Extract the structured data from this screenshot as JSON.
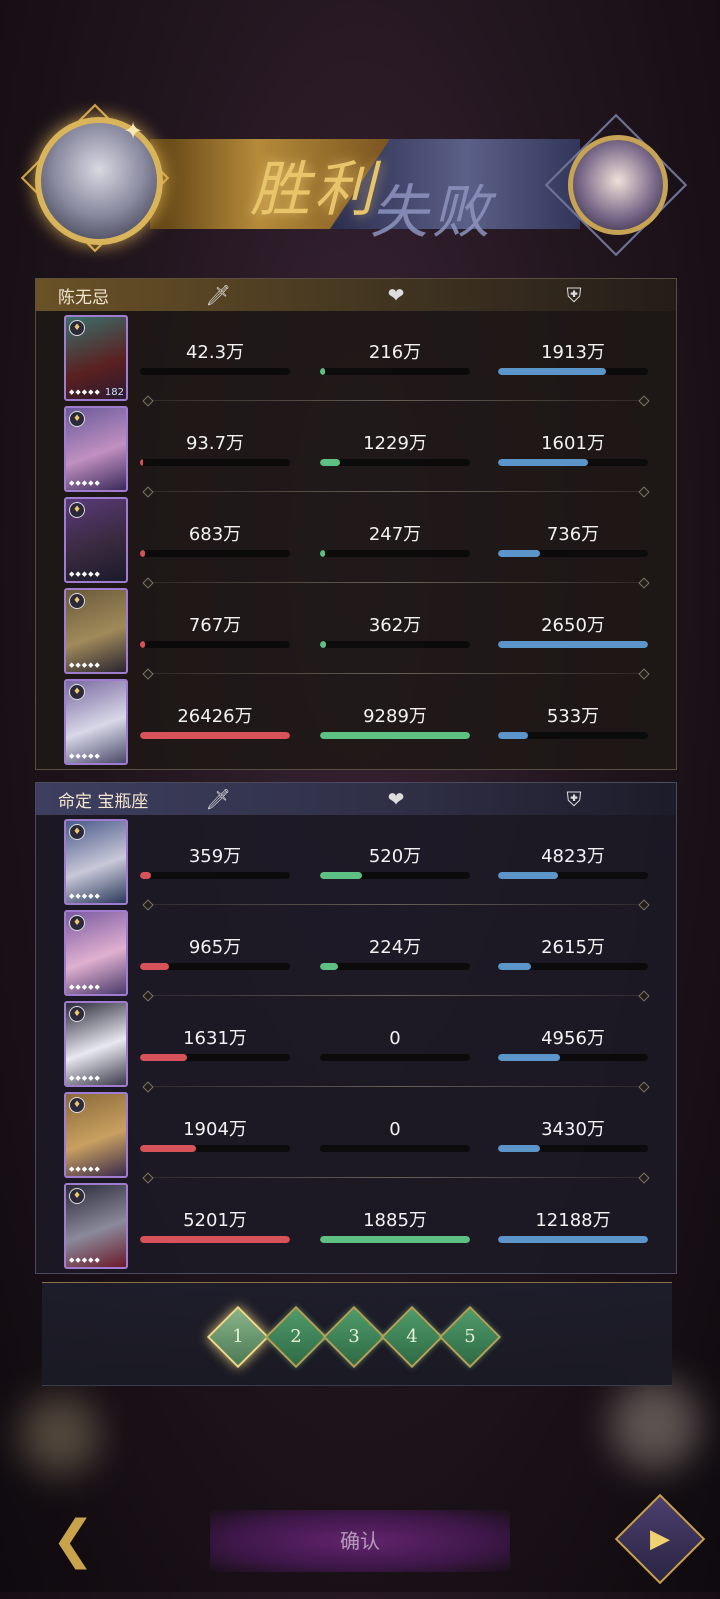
{
  "result": {
    "win_text": "胜利",
    "lose_text": "失败"
  },
  "panels": [
    {
      "name": "陈无忌",
      "theme": "gold",
      "rows": [
        {
          "level": "182",
          "atk": "42.3万",
          "heal": "216万",
          "def": "1913万",
          "atk_pct": 0,
          "heal_pct": 0.03,
          "def_pct": 0.72
        },
        {
          "level": "",
          "atk": "93.7万",
          "heal": "1229万",
          "def": "1601万",
          "atk_pct": 0.01,
          "heal_pct": 0.13,
          "def_pct": 0.6
        },
        {
          "level": "",
          "atk": "683万",
          "heal": "247万",
          "def": "736万",
          "atk_pct": 0.03,
          "heal_pct": 0.03,
          "def_pct": 0.28
        },
        {
          "level": "",
          "atk": "767万",
          "heal": "362万",
          "def": "2650万",
          "atk_pct": 0.03,
          "heal_pct": 0.04,
          "def_pct": 1.0
        },
        {
          "level": "",
          "atk": "26426万",
          "heal": "9289万",
          "def": "533万",
          "atk_pct": 1.0,
          "heal_pct": 1.0,
          "def_pct": 0.2
        }
      ]
    },
    {
      "name": "命定 宝瓶座",
      "theme": "blue",
      "rows": [
        {
          "level": "",
          "atk": "359万",
          "heal": "520万",
          "def": "4823万",
          "atk_pct": 0.07,
          "heal_pct": 0.28,
          "def_pct": 0.4
        },
        {
          "level": "",
          "atk": "965万",
          "heal": "224万",
          "def": "2615万",
          "atk_pct": 0.19,
          "heal_pct": 0.12,
          "def_pct": 0.22
        },
        {
          "level": "",
          "atk": "1631万",
          "heal": "0",
          "def": "4956万",
          "atk_pct": 0.31,
          "heal_pct": 0,
          "def_pct": 0.41
        },
        {
          "level": "",
          "atk": "1904万",
          "heal": "0",
          "def": "3430万",
          "atk_pct": 0.37,
          "heal_pct": 0,
          "def_pct": 0.28
        },
        {
          "level": "",
          "atk": "5201万",
          "heal": "1885万",
          "def": "12188万",
          "atk_pct": 1.0,
          "heal_pct": 1.0,
          "def_pct": 1.0
        }
      ]
    }
  ],
  "tabs": [
    "1",
    "2",
    "3",
    "4",
    "5"
  ],
  "active_tab": 0,
  "confirm_label": "确认",
  "icons": {
    "attack": "sword-icon",
    "heal": "heart-icon",
    "defense": "shield-icon",
    "back": "back-arrow-icon",
    "replay": "replay-icon"
  },
  "colors": {
    "atk": "#d8525a",
    "heal": "#5dc183",
    "def": "#5c95c9"
  }
}
